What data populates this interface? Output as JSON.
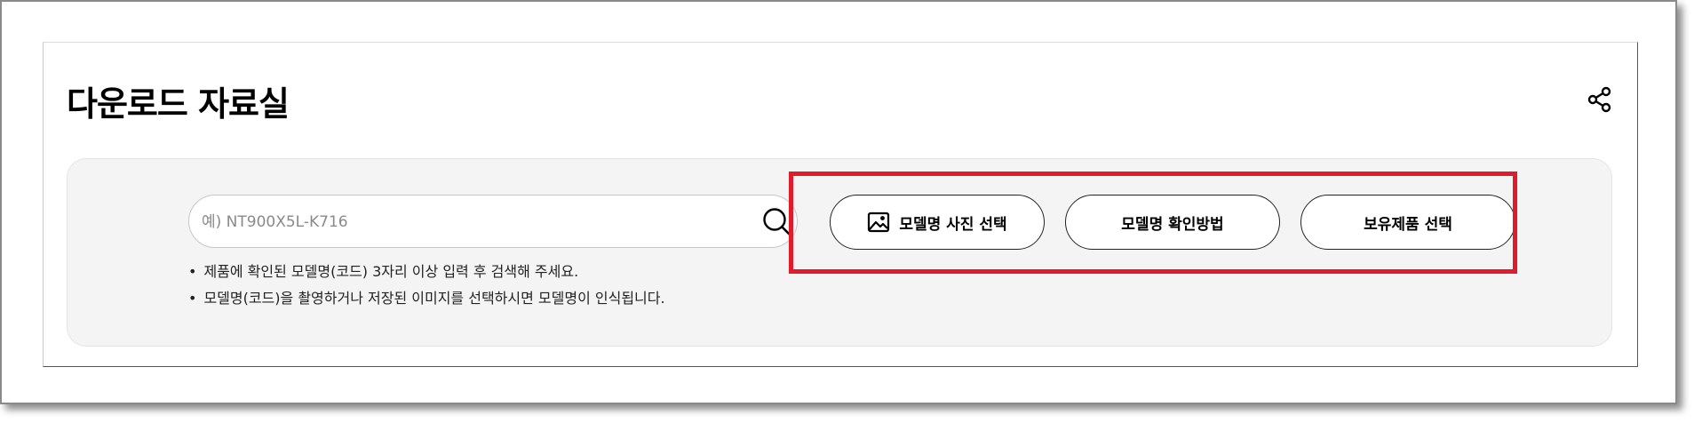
{
  "page": {
    "title": "다운로드 자료실"
  },
  "search": {
    "placeholder": "예) NT900X5L-K716",
    "value": ""
  },
  "notes": [
    "제품에 확인된 모델명(코드) 3자리 이상 입력 후 검색해 주세요.",
    "모델명(코드)을 촬영하거나 저장된 이미지를 선택하시면 모델명이 인식됩니다."
  ],
  "buttons": {
    "photo_select": "모델명 사진 선택",
    "how_to_check": "모델명 확인방법",
    "owned_product": "보유제품 선택"
  },
  "icons": {
    "share": "share-icon",
    "search": "search-icon",
    "image": "image-icon"
  },
  "colors": {
    "highlight": "#e11b2b",
    "panel_bg": "#f4f4f4"
  }
}
